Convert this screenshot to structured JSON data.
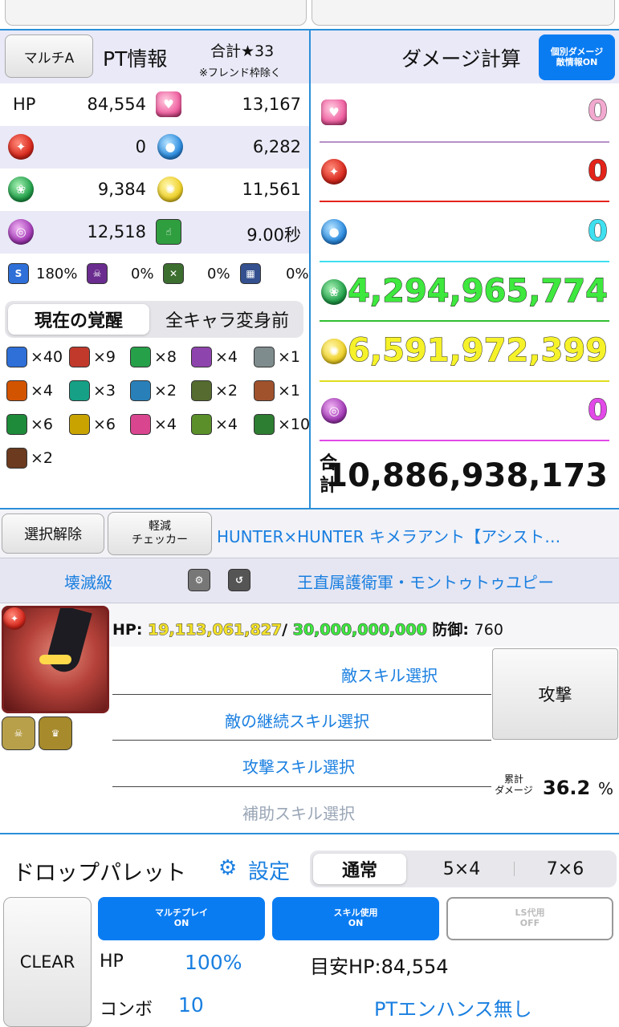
{
  "header": {
    "multi_button": "マルチA",
    "pt_info": "PT情報",
    "total_stars": "合計★33",
    "friend_note": "※フレンド枠除く",
    "damage_title": "ダメージ計算",
    "individual_damage_button": [
      "個別ダメージ",
      "敵情報ON"
    ]
  },
  "pt_stats": {
    "hp_label": "HP",
    "hp": "84,554",
    "heart": "13,167",
    "fire": "0",
    "water": "6,282",
    "wood": "9,384",
    "light": "11,561",
    "dark": "12,518",
    "move_time": "9.00秒"
  },
  "resist": {
    "skill_boost": "180%",
    "poison": "0%",
    "bind": "0%",
    "jammer": "0%"
  },
  "awakening_tabs": {
    "active": "現在の覚醒",
    "other": "全キャラ変身前"
  },
  "awakenings": [
    {
      "icon": "skill-boost-plus-icon",
      "count": "×40",
      "color": "#2e6fd8"
    },
    {
      "icon": "skill-boost-icon",
      "count": "×9",
      "color": "#c0392b"
    },
    {
      "icon": "extend-time-plus-icon",
      "count": "×8",
      "color": "#27a04a"
    },
    {
      "icon": "seven-combo-icon",
      "count": "×4",
      "color": "#8e44ad"
    },
    {
      "icon": "multi-orb-icon",
      "count": "×1",
      "color": "#7f8c8d"
    },
    {
      "icon": "cross-orb-icon",
      "count": "×4",
      "color": "#d35400"
    },
    {
      "icon": "three-color-icon",
      "count": "×3",
      "color": "#16a085"
    },
    {
      "icon": "four-color-icon",
      "count": "×2",
      "color": "#2980b9"
    },
    {
      "icon": "no-skyfall-icon",
      "count": "×2",
      "color": "#556b2f"
    },
    {
      "icon": "chain-icon",
      "count": "×1",
      "color": "#a0522d"
    },
    {
      "icon": "wood-row-icon",
      "count": "×6",
      "color": "#1e8b3a"
    },
    {
      "icon": "light-row-icon",
      "count": "×6",
      "color": "#c9a400"
    },
    {
      "icon": "heart-cross-icon",
      "count": "×4",
      "color": "#d9468f"
    },
    {
      "icon": "bonus-attack-icon",
      "count": "×4",
      "color": "#5a8f29"
    },
    {
      "icon": "wood-enhanced-icon",
      "count": "×10",
      "color": "#2d7d32"
    },
    {
      "icon": "dark-resist-icon",
      "count": "×2",
      "color": "#6b3a1f"
    }
  ],
  "damage": {
    "heart": "0",
    "fire": "0",
    "water": "0",
    "wood": "4,294,965,774",
    "light": "6,591,972,399",
    "dark": "0",
    "total_label": "合計",
    "total": "10,886,938,173",
    "colors": {
      "heart": "#f2a9cf",
      "fire": "#e3241b",
      "water": "#3fe0f0",
      "wood": "#3ee83e",
      "light": "#f6f22a",
      "dark": "#e24ae8"
    }
  },
  "enemy_bar": {
    "deselect": "選択解除",
    "checker_line1": "軽減",
    "checker_line2": "チェッカー",
    "dungeon": "HUNTER×HUNTER キメラアント【アシスト…",
    "difficulty": "壊滅級",
    "enemy_name": "王直属護衛軍・モントゥトゥユピー"
  },
  "enemy": {
    "hp_label": "HP:",
    "hp_current": "19,113,061,827",
    "hp_sep": "/",
    "hp_max": "30,000,000,000",
    "def_label": "防御:",
    "defense": "760",
    "enemy_skill": "敵スキル選択",
    "enemy_cont_skill": "敵の継続スキル選択",
    "attack_skill": "攻撃スキル選択",
    "support_skill": "補助スキル選択",
    "attack_button": "攻撃",
    "cumulative_label_1": "累計",
    "cumulative_label_2": "ダメージ",
    "cumulative_value": "36.2",
    "cumulative_unit": "%"
  },
  "palette": {
    "title": "ドロップパレット",
    "settings": "設定",
    "tabs": [
      "通常",
      "5×4",
      "7×6"
    ],
    "active_tab": 0,
    "clear": "CLEAR",
    "multiplay": [
      "マルチプレイ",
      "ON"
    ],
    "skill_use": [
      "スキル使用",
      "ON"
    ],
    "ls_sub": [
      "LS代用",
      "OFF"
    ],
    "hp_label": "HP",
    "hp_percent": "100%",
    "estimate": "目安HP:84,554",
    "combo_label": "コンボ",
    "combo": "10",
    "enhance": "PTエンハンス無し"
  }
}
